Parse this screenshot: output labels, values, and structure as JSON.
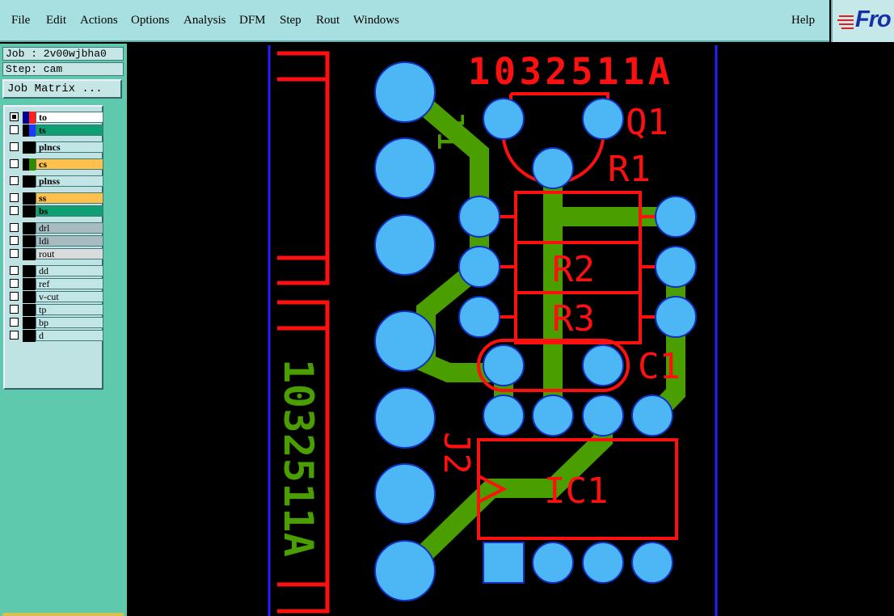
{
  "menu": {
    "items": [
      "File",
      "Edit",
      "Actions",
      "Options",
      "Analysis",
      "DFM",
      "Step",
      "Rout",
      "Windows"
    ],
    "help": "Help"
  },
  "logo": {
    "text": "Fro"
  },
  "job": {
    "label": "Job : 2v00wjbha0",
    "step": "Step: cam"
  },
  "job_matrix_button": "Job Matrix ...",
  "layers": [
    {
      "name": "to",
      "color": "#ffffff",
      "checked": true
    },
    {
      "name": "ts",
      "color": "#0e9f72",
      "checked": false
    },
    {
      "name": "plncs",
      "color": "#c2e5e5",
      "checked": false
    },
    {
      "name": "cs",
      "color": "#ffc04c",
      "checked": false
    },
    {
      "name": "plnss",
      "color": "#c2e5e5",
      "checked": false
    },
    {
      "name": "ss",
      "color": "#ffc04c",
      "checked": false
    },
    {
      "name": "bs",
      "color": "#0e9f72",
      "checked": false
    },
    {
      "name": "drl",
      "color": "#a6bcc0",
      "checked": false
    },
    {
      "name": "ldi",
      "color": "#a6bcc0",
      "checked": false
    },
    {
      "name": "rout",
      "color": "#d8dcdc",
      "checked": false
    },
    {
      "name": "dd",
      "color": "#c2e5e5",
      "checked": false
    },
    {
      "name": "ref",
      "color": "#c2e5e5",
      "checked": false
    },
    {
      "name": "v-cut",
      "color": "#c2e5e5",
      "checked": false
    },
    {
      "name": "tp",
      "color": "#c2e5e5",
      "checked": false
    },
    {
      "name": "bp",
      "color": "#c2e5e5",
      "checked": false
    },
    {
      "name": "d",
      "color": "#c2e5e5",
      "checked": false
    }
  ],
  "pcb": {
    "top_label": "1032511A",
    "vertical_label": "1032511A",
    "refs": {
      "q1": "Q1",
      "r1": "R1",
      "r2": "R2",
      "r3": "R3",
      "c1": "C1",
      "ic1": "IC1",
      "j1": "J1",
      "j2": "J2"
    },
    "colors": {
      "silk": "#ff0000",
      "pad": "#4db7f5",
      "trace": "#4a9e00",
      "outline": "#1010ff"
    }
  }
}
